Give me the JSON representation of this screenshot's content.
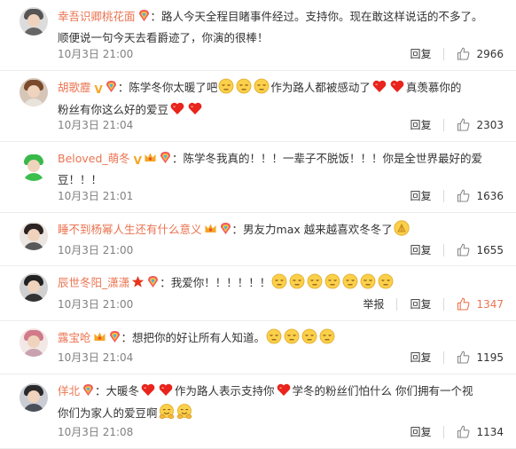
{
  "comments": [
    {
      "username": "幸吾识卿桃花面",
      "badges": [
        "rainbow"
      ],
      "lines": [
        [
          {
            "t": "：路人今天全程目睹事件经过。支持你。现在敢这样说话的不多了。"
          }
        ],
        [
          {
            "t": "顺便说一句今天去看爵迹了，你演的很棒！"
          }
        ]
      ],
      "time": "10月3日 21:00",
      "reply": "回复",
      "likes": "2966",
      "avatar": [
        "#dcdcdc",
        "#555",
        "#666"
      ]
    },
    {
      "username": "胡歌靂",
      "badges": [
        "vip",
        "rainbow"
      ],
      "lines": [
        [
          {
            "t": "：陈学冬你太暖了吧"
          },
          {
            "e": "sad"
          },
          {
            "e": "sad"
          },
          {
            "e": "sad"
          },
          {
            "t": "作为路人都被感动了"
          },
          {
            "e": "heart"
          },
          {
            "e": "heart"
          },
          {
            "t": "真羡慕你的"
          }
        ],
        [
          {
            "t": "粉丝有你这么好的爱豆"
          },
          {
            "e": "heart"
          },
          {
            "e": "heart"
          }
        ]
      ],
      "time": "10月3日 21:04",
      "reply": "回复",
      "likes": "2303",
      "avatar": [
        "#d6c6b8",
        "#7a4a2a",
        "#e9e3dc"
      ]
    },
    {
      "username": "Beloved_萌冬",
      "badges": [
        "vip",
        "crown",
        "rainbow"
      ],
      "lines": [
        [
          {
            "t": "：陈学冬我真的！！！一辈子不脱饭！！！你是全世界最好的爱"
          }
        ],
        [
          {
            "t": "豆！！！"
          }
        ]
      ],
      "time": "10月3日 21:01",
      "reply": "回复",
      "likes": "1636",
      "avatar": [
        "#ffffff",
        "#38b94a",
        "#3cbf4e"
      ]
    },
    {
      "username": "睡不到杨幂人生还有什么意义",
      "badges": [
        "crown",
        "rainbow"
      ],
      "lines": [
        [
          {
            "t": "：男友力max 越来越喜欢冬冬了"
          },
          {
            "e": "clap"
          }
        ]
      ],
      "time": "10月3日 21:00",
      "reply": "回复",
      "likes": "1655",
      "avatar": [
        "#ece6e2",
        "#2c2422",
        "#5a5a5a"
      ]
    },
    {
      "username": "辰世冬阳_潇潇",
      "badges": [
        "star",
        "rainbow"
      ],
      "lines": [
        [
          {
            "t": "：我爱你！！！！！！"
          },
          {
            "e": "sad"
          },
          {
            "e": "sad"
          },
          {
            "e": "sad"
          },
          {
            "e": "sad"
          },
          {
            "e": "sad"
          },
          {
            "e": "sad"
          },
          {
            "e": "sad"
          }
        ]
      ],
      "time": "10月3日 21:00",
      "report": "举报",
      "reply": "回复",
      "likes": "1347",
      "liked": true,
      "avatar": [
        "#d0d0d0",
        "#222",
        "#333"
      ]
    },
    {
      "username": "露宝呛",
      "badges": [
        "crown",
        "rainbow"
      ],
      "lines": [
        [
          {
            "t": "：想把你的好让所有人知道。"
          },
          {
            "e": "sad"
          },
          {
            "e": "sad"
          },
          {
            "e": "sad"
          },
          {
            "e": "sad"
          }
        ]
      ],
      "time": "10月3日 21:04",
      "reply": "回复",
      "likes": "1195",
      "avatar": [
        "#f2e8e6",
        "#d17a8a",
        "#c9a2b0"
      ]
    },
    {
      "username": "佯北",
      "badges": [
        "rainbow"
      ],
      "lines": [
        [
          {
            "t": "：大暖冬"
          },
          {
            "e": "heart"
          },
          {
            "e": "heart"
          },
          {
            "t": "作为路人表示支持你"
          },
          {
            "e": "heart"
          },
          {
            "t": "学冬的粉丝们怕什么 你们拥有一个视"
          }
        ],
        [
          {
            "t": "你们为家人的爱豆啊"
          },
          {
            "e": "hug"
          },
          {
            "e": "hug"
          }
        ]
      ],
      "time": "10月3日 21:08",
      "reply": "回复",
      "likes": "1134",
      "avatar": [
        "#c9ccd2",
        "#2a2a2a",
        "#4a4f5a"
      ]
    }
  ],
  "colors": {
    "username": "#eb7350",
    "meta": "#808080",
    "liked": "#eb7350",
    "divider": "#ececec"
  }
}
